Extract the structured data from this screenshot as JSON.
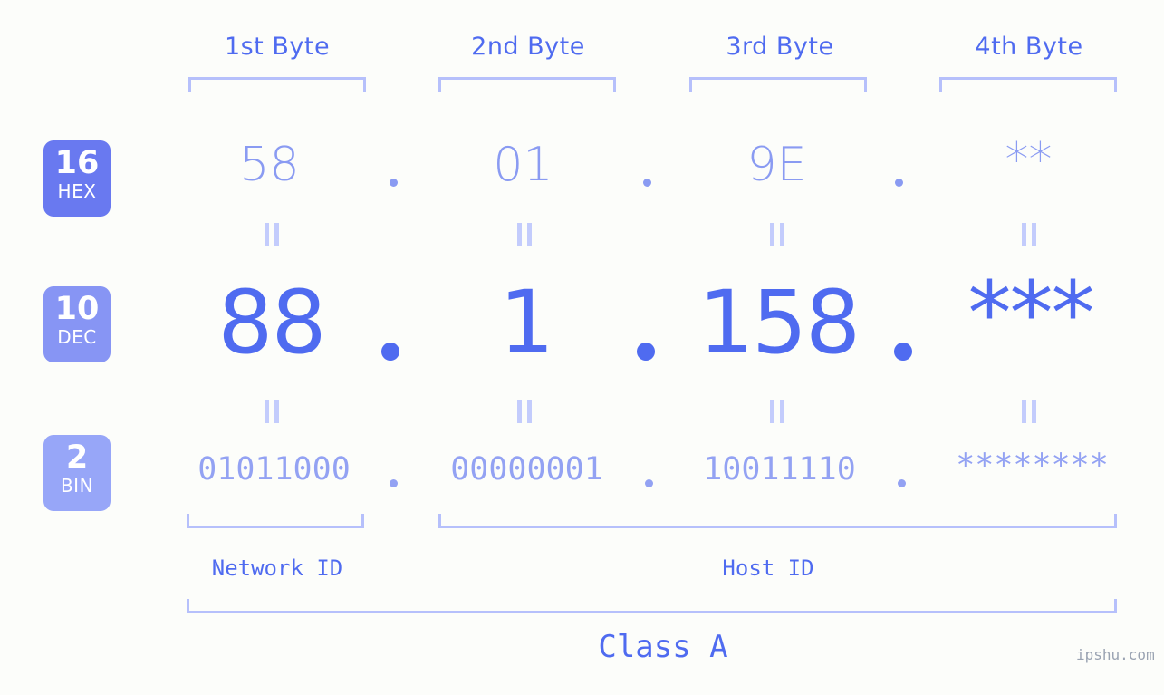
{
  "meta": {
    "watermark": "ipshu.com",
    "background_color": "#fcfdfa",
    "accent_color": "#4f6bf0",
    "accent_light_color": "#b6c0fb"
  },
  "headers": {
    "byte1": "1st Byte",
    "byte2": "2nd Byte",
    "byte3": "3rd Byte",
    "byte4": "4th Byte"
  },
  "badges": {
    "hex": {
      "num": "16",
      "label": "HEX",
      "color": "#6979f0"
    },
    "dec": {
      "num": "10",
      "label": "DEC",
      "color": "#8795f4"
    },
    "bin": {
      "num": "2",
      "label": "BIN",
      "color": "#97a6f8"
    }
  },
  "rows": {
    "hex": {
      "byte1": "58",
      "byte2": "01",
      "byte3": "9E",
      "byte4": "**",
      "separator": "."
    },
    "dec": {
      "byte1": "88",
      "byte2": "1",
      "byte3": "158",
      "byte4": "***",
      "separator": "."
    },
    "bin": {
      "byte1": "01011000",
      "byte2": "00000001",
      "byte3": "10011110",
      "byte4": "********",
      "separator": "."
    }
  },
  "equals_symbol": "=",
  "zones": {
    "network_id": "Network ID",
    "host_id": "Host ID",
    "class": "Class A"
  }
}
